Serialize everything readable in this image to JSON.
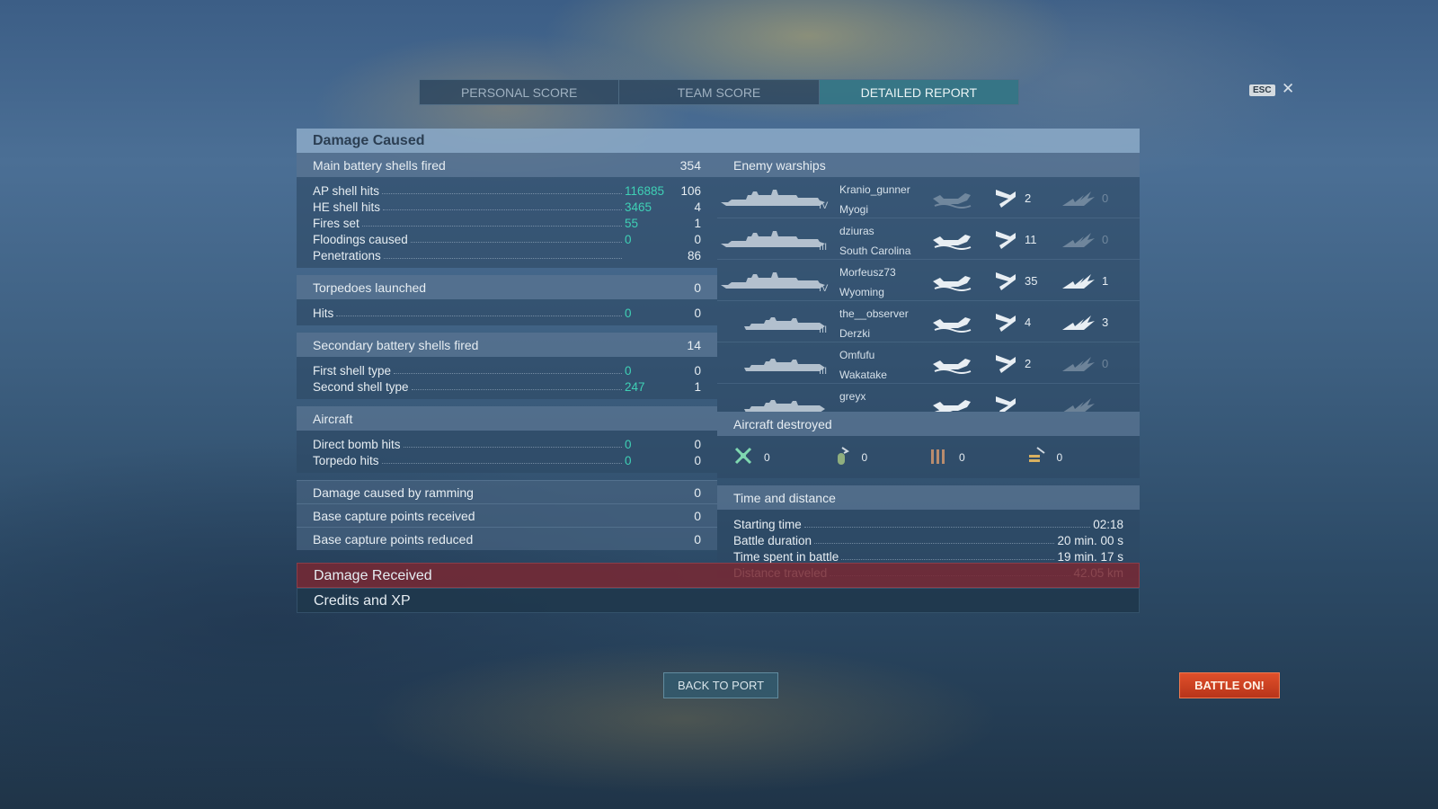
{
  "tabs": {
    "personal": "PERSONAL SCORE",
    "team": "TEAM SCORE",
    "detailed": "DETAILED REPORT"
  },
  "esc_label": "ESC",
  "close_glyph": "✕",
  "damage_caused": {
    "title": "Damage Caused",
    "main_battery": {
      "label": "Main battery shells fired",
      "value": "354",
      "rows": [
        {
          "label": "AP shell hits",
          "damage": "116885",
          "count": "106"
        },
        {
          "label": "HE shell hits",
          "damage": "3465",
          "count": "4"
        },
        {
          "label": "Fires set",
          "damage": "55",
          "count": "1"
        },
        {
          "label": "Floodings caused",
          "damage": "0",
          "count": "0"
        },
        {
          "label": "Penetrations",
          "damage": "",
          "count": "86"
        }
      ]
    },
    "torpedoes": {
      "label": "Torpedoes launched",
      "value": "0",
      "rows": [
        {
          "label": "Hits",
          "damage": "0",
          "count": "0"
        }
      ]
    },
    "secondary": {
      "label": "Secondary battery shells fired",
      "value": "14",
      "rows": [
        {
          "label": "First shell type",
          "damage": "0",
          "count": "0"
        },
        {
          "label": "Second shell type",
          "damage": "247",
          "count": "1"
        }
      ]
    },
    "aircraft": {
      "label": "Aircraft",
      "rows": [
        {
          "label": "Direct bomb hits",
          "damage": "0",
          "count": "0"
        },
        {
          "label": "Torpedo hits",
          "damage": "0",
          "count": "0"
        }
      ]
    },
    "ramming": {
      "label": "Damage caused by ramming",
      "value": "0"
    },
    "capture_received": {
      "label": "Base capture points received",
      "value": "0"
    },
    "capture_reduced": {
      "label": "Base capture points reduced",
      "value": "0"
    }
  },
  "enemy_warships": {
    "title": "Enemy warships",
    "ships": [
      {
        "player": "Kranio_gunner",
        "ship": "Myogi",
        "tier": "IV",
        "spotted": false,
        "hits": "2",
        "kills": "0",
        "kills_active": false
      },
      {
        "player": "dziuras",
        "ship": "South Carolina",
        "tier": "III",
        "spotted": true,
        "hits": "11",
        "kills": "0",
        "kills_active": false
      },
      {
        "player": "Morfeusz73",
        "ship": "Wyoming",
        "tier": "IV",
        "spotted": true,
        "hits": "35",
        "kills": "1",
        "kills_active": true
      },
      {
        "player": "the__observer",
        "ship": "Derzki",
        "tier": "III",
        "spotted": true,
        "hits": "4",
        "kills": "3",
        "kills_active": true
      },
      {
        "player": "Omfufu",
        "ship": "Wakatake",
        "tier": "III",
        "spotted": true,
        "hits": "2",
        "kills": "0",
        "kills_active": false
      },
      {
        "player": "greyx",
        "ship": "",
        "tier": "",
        "spotted": true,
        "hits": "",
        "kills": "",
        "kills_active": false
      }
    ]
  },
  "aircraft_destroyed": {
    "title": "Aircraft destroyed",
    "items": [
      {
        "icon": "fighter-plane-icon",
        "value": "0"
      },
      {
        "icon": "bomb-icon",
        "value": "0"
      },
      {
        "icon": "torpedo-bomber-icon",
        "value": "0"
      },
      {
        "icon": "dive-bomber-icon",
        "value": "0"
      }
    ]
  },
  "time_distance": {
    "title": "Time and distance",
    "rows": [
      {
        "label": "Starting time",
        "value": "02:18"
      },
      {
        "label": "Battle duration",
        "value": "20 min. 00 s"
      },
      {
        "label": "Time spent in battle",
        "value": "19 min. 17 s"
      },
      {
        "label": "Distance traveled",
        "value": "42.05 km"
      }
    ]
  },
  "damage_received": {
    "title": "Damage Received"
  },
  "credits_xp": {
    "title": "Credits and XP"
  },
  "buttons": {
    "back": "BACK TO PORT",
    "battle": "BATTLE ON!"
  },
  "colors": {
    "accent": "#3fd0b5",
    "battle_button": "#c93e1f",
    "damage_received": "#7a2832"
  }
}
